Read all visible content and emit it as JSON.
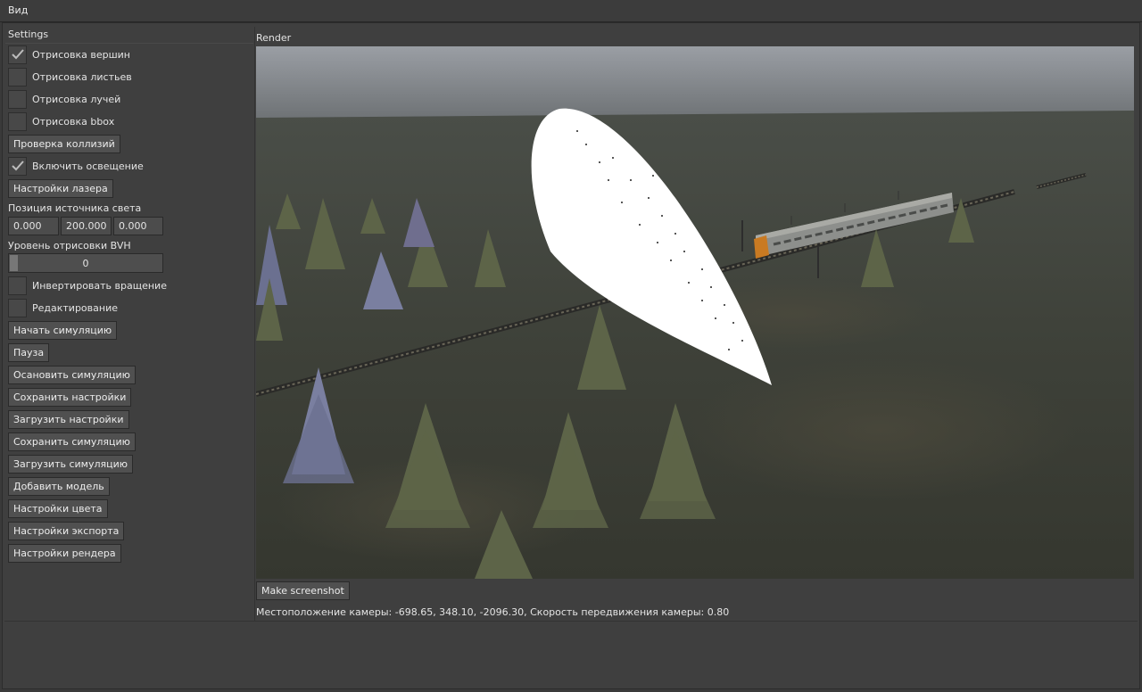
{
  "menu": {
    "view_label": "Вид"
  },
  "settings": {
    "title": "Settings",
    "draw_vertices": {
      "label": "Отрисовка вершин",
      "checked": true
    },
    "draw_leaves": {
      "label": "Отрисовка листьев",
      "checked": false
    },
    "draw_rays": {
      "label": "Отрисовка лучей",
      "checked": false
    },
    "draw_bbox": {
      "label": "Отрисовка bbox",
      "checked": false
    },
    "collision_check_label": "Проверка коллизий",
    "enable_lighting": {
      "label": "Включить освещение",
      "checked": true
    },
    "laser_settings_label": "Настройки лазера",
    "light_position": {
      "label": "Позиция источника света",
      "x": "0.000",
      "y": "200.000",
      "z": "0.000"
    },
    "bvh_level": {
      "label": "Уровень отрисовки BVH",
      "value": "0"
    },
    "invert_rotation": {
      "label": "Инвертировать вращение",
      "checked": false
    },
    "editing": {
      "label": "Редактирование",
      "checked": false
    },
    "buttons": {
      "start_simulation": "Начать симуляцию",
      "pause": "Пауза",
      "stop_simulation": "Осановить симуляцию",
      "save_settings": "Сохранить настройки",
      "load_settings": "Загрузить настройки",
      "save_simulation": "Сохранить симуляцию",
      "load_simulation": "Загрузить симуляцию",
      "add_model": "Добавить модель",
      "color_settings": "Настройки цвета",
      "export_settings": "Настройки экспорта",
      "render_settings": "Настройки рендера"
    }
  },
  "render": {
    "title": "Render",
    "screenshot_button": "Make screenshot",
    "camera_status": "Местоположение камеры: -698.65, 348.10, -2096.30, Скорость передвижения камеры: 0.80"
  }
}
